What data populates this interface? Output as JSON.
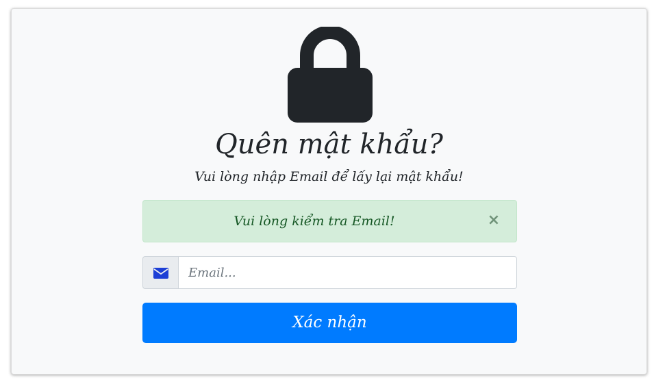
{
  "page": {
    "title": "Quên mật khẩu?",
    "subtitle": "Vui lòng nhập Email để lấy lại mật khẩu!"
  },
  "alert": {
    "message": "Vui lòng kiểm tra Email!",
    "close_label": "×",
    "type": "success"
  },
  "email_field": {
    "placeholder": "Email...",
    "value": "",
    "icon": "envelope-icon"
  },
  "submit": {
    "label": "Xác nhận"
  },
  "icons": {
    "header": "lock-icon"
  },
  "colors": {
    "primary": "#007bff",
    "success_bg": "#d4edda",
    "success_text": "#155724",
    "envelope_icon": "#1d3fd6",
    "lock": "#212529"
  }
}
